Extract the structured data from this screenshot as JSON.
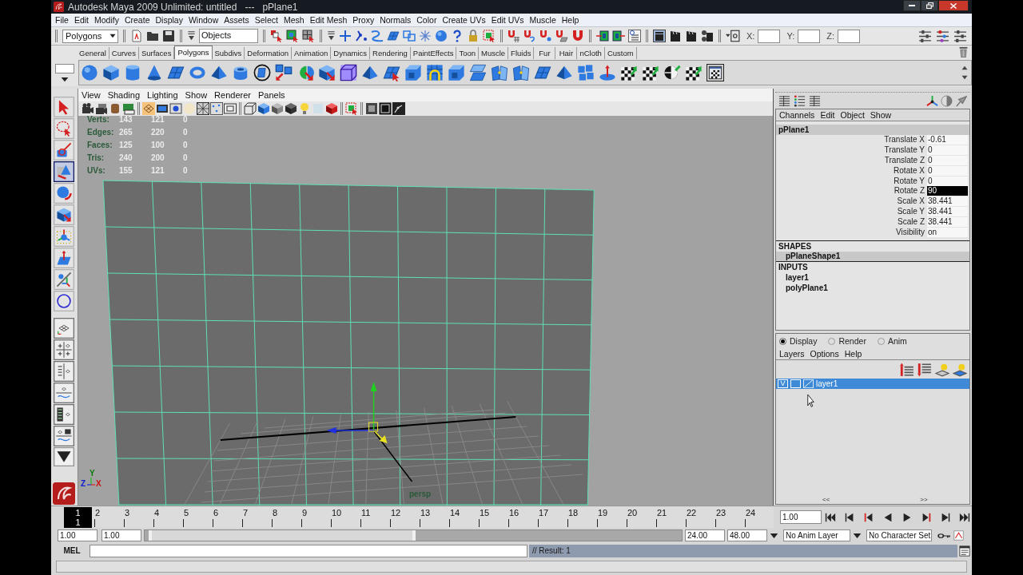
{
  "window": {
    "title": "Autodesk Maya 2009 Unlimited: untitled   ---   pPlane1"
  },
  "menu_bar": [
    "File",
    "Edit",
    "Modify",
    "Create",
    "Display",
    "Window",
    "Assets",
    "Select",
    "Mesh",
    "Edit Mesh",
    "Proxy",
    "Normals",
    "Color",
    "Create UVs",
    "Edit UVs",
    "Muscle",
    "Help"
  ],
  "status_line": {
    "menu_set": "Polygons",
    "selection_mask": "Objects",
    "coordinate_fields": [
      {
        "label": "X:"
      },
      {
        "label": "Y:"
      },
      {
        "label": "Z:"
      }
    ]
  },
  "shelf": {
    "tabs": [
      {
        "label": "General",
        "selected": false
      },
      {
        "label": "Curves",
        "selected": false
      },
      {
        "label": "Surfaces",
        "selected": false
      },
      {
        "label": "Polygons",
        "selected": true
      },
      {
        "label": "Subdivs",
        "selected": false
      },
      {
        "label": "Deformation",
        "selected": false
      },
      {
        "label": "Animation",
        "selected": false
      },
      {
        "label": "Dynamics",
        "selected": false
      },
      {
        "label": "Rendering",
        "selected": false
      },
      {
        "label": "PaintEffects",
        "selected": false
      },
      {
        "label": "Toon",
        "selected": false
      },
      {
        "label": "Muscle",
        "selected": false
      },
      {
        "label": "Fluids",
        "selected": false
      },
      {
        "label": "Fur",
        "selected": false
      },
      {
        "label": "Hair",
        "selected": false
      },
      {
        "label": "nCloth",
        "selected": false
      },
      {
        "label": "Custom",
        "selected": false
      }
    ]
  },
  "toolbox": {
    "tools": [
      {
        "selected": false
      },
      {
        "selected": false
      },
      {
        "selected": false
      },
      {
        "selected": true
      },
      {
        "selected": false
      },
      {
        "selected": false
      },
      {
        "selected": false
      },
      {
        "selected": false
      },
      {
        "selected": false
      },
      {
        "selected": false
      }
    ]
  },
  "viewport": {
    "menu": [
      "View",
      "Shading",
      "Lighting",
      "Show",
      "Renderer",
      "Panels"
    ],
    "stats": [
      {
        "label": "Verts:",
        "values": [
          "143",
          "121",
          "0"
        ]
      },
      {
        "label": "Edges:",
        "values": [
          "265",
          "220",
          "0"
        ]
      },
      {
        "label": "Faces:",
        "values": [
          "125",
          "100",
          "0"
        ]
      },
      {
        "label": "Tris:",
        "values": [
          "240",
          "200",
          "0"
        ]
      },
      {
        "label": "UVs:",
        "values": [
          "155",
          "121",
          "0"
        ]
      }
    ],
    "camera": "persp",
    "axes": [
      {
        "label": "Y",
        "color": "#0a7a0a"
      },
      {
        "label": "Z",
        "color": "#1020d0"
      },
      {
        "label": "X",
        "color": "#d01010"
      }
    ]
  },
  "channel_box": {
    "menu": [
      "Channels",
      "Edit",
      "Object",
      "Show"
    ],
    "object": "pPlane1",
    "attributes": [
      {
        "name": "Translate X",
        "value": "-0.61",
        "selected": false
      },
      {
        "name": "Translate Y",
        "value": "0",
        "selected": false
      },
      {
        "name": "Translate Z",
        "value": "0",
        "selected": false
      },
      {
        "name": "Rotate X",
        "value": "0",
        "selected": false
      },
      {
        "name": "Rotate Y",
        "value": "0",
        "selected": false
      },
      {
        "name": "Rotate Z",
        "value": "90",
        "selected": true
      },
      {
        "name": "Scale X",
        "value": "38.441",
        "selected": false
      },
      {
        "name": "Scale Y",
        "value": "38.441",
        "selected": false
      },
      {
        "name": "Scale Z",
        "value": "38.441",
        "selected": false
      },
      {
        "name": "Visibility",
        "value": "on",
        "selected": false
      }
    ],
    "shapes_heading": "SHAPES",
    "shapes": [
      {
        "name": "pPlaneShape1",
        "selected": true
      }
    ],
    "inputs_heading": "INPUTS",
    "inputs": [
      "layer1",
      "polyPlane1"
    ]
  },
  "layer_editor": {
    "modes": [
      {
        "label": "Display",
        "selected": true
      },
      {
        "label": "Render",
        "selected": false
      },
      {
        "label": "Anim",
        "selected": false
      }
    ],
    "menu": [
      "Layers",
      "Options",
      "Help"
    ],
    "layers": [
      {
        "visibility": "V",
        "name": "layer1",
        "selected": true
      }
    ],
    "pane_arrows": [
      "<<",
      ">>"
    ]
  },
  "time_slider": {
    "ticks": [
      {
        "label": "1",
        "current": true
      },
      {
        "label": "2",
        "current": false
      },
      {
        "label": "3",
        "current": false
      },
      {
        "label": "4",
        "current": false
      },
      {
        "label": "5",
        "current": false
      },
      {
        "label": "6",
        "current": false
      },
      {
        "label": "7",
        "current": false
      },
      {
        "label": "8",
        "current": false
      },
      {
        "label": "9",
        "current": false
      },
      {
        "label": "10",
        "current": false
      },
      {
        "label": "11",
        "current": false
      },
      {
        "label": "12",
        "current": false
      },
      {
        "label": "13",
        "current": false
      },
      {
        "label": "14",
        "current": false
      },
      {
        "label": "15",
        "current": false
      },
      {
        "label": "16",
        "current": false
      },
      {
        "label": "17",
        "current": false
      },
      {
        "label": "18",
        "current": false
      },
      {
        "label": "19",
        "current": false
      },
      {
        "label": "20",
        "current": false
      },
      {
        "label": "21",
        "current": false
      },
      {
        "label": "22",
        "current": false
      },
      {
        "label": "23",
        "current": false
      },
      {
        "label": "24",
        "current": false
      }
    ],
    "current_frame": "1",
    "current_time": "1.00"
  },
  "range_slider": {
    "start_time": "1.00",
    "playback_start": "1.00",
    "level": 0.5,
    "playback_end": "24.00",
    "end_time": "48.00",
    "anim_layer": "No Anim Layer",
    "character_set": "No Character Set"
  },
  "command_line": {
    "language": "MEL",
    "result": "// Result: 1"
  }
}
